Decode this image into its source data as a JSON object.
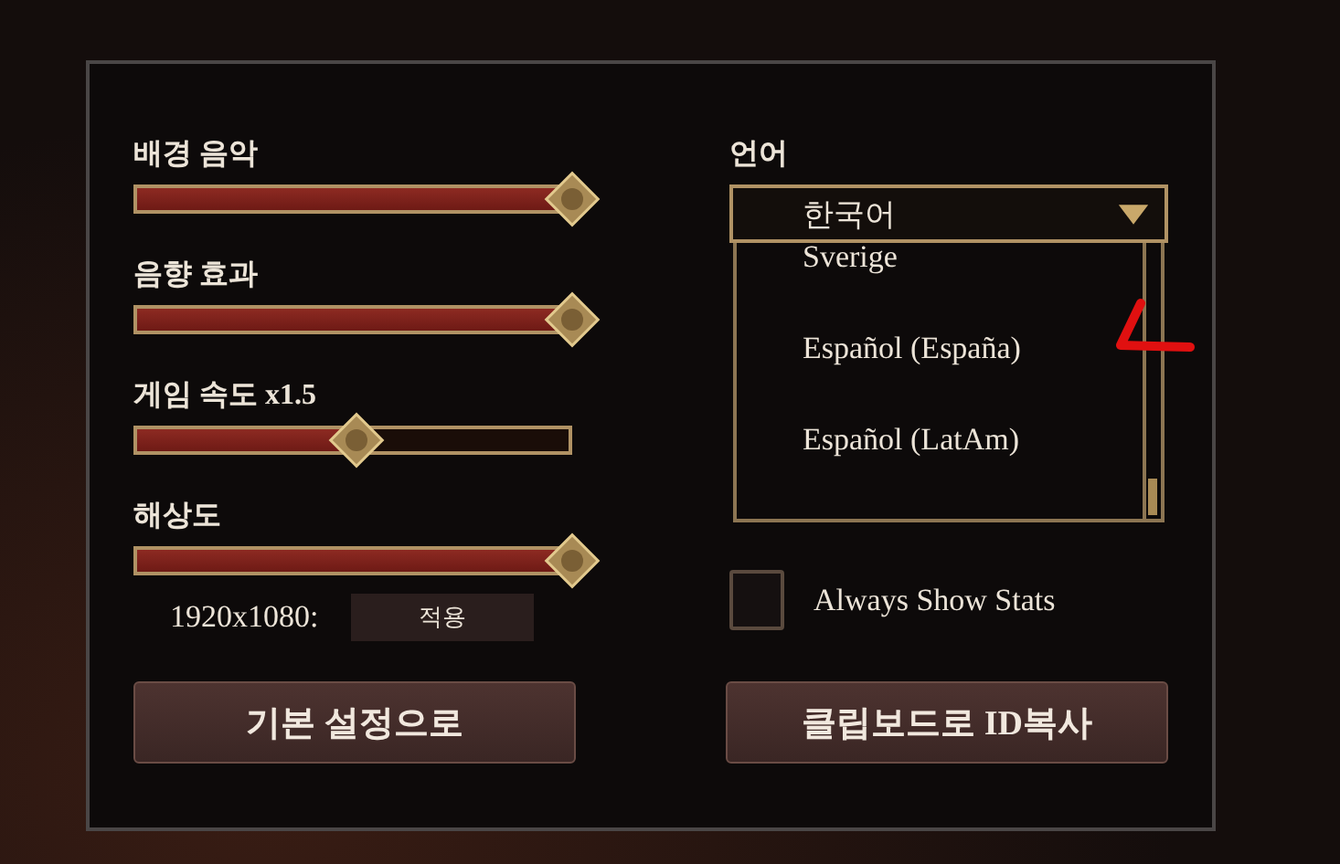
{
  "sliders": [
    {
      "label": "배경 음악",
      "level": 1.0
    },
    {
      "label": "음향 효과",
      "level": 1.0
    },
    {
      "label": "게임 속도 x1.5",
      "level": 0.51
    },
    {
      "label": "해상도",
      "level": 1.0
    }
  ],
  "resolution": {
    "value": "1920x1080:",
    "apply_button": "적용"
  },
  "language": {
    "label": "언어",
    "value": "한국어",
    "expanded": true,
    "options": [
      {
        "label": "Sverige"
      },
      {
        "label": "Español (España)"
      },
      {
        "label": "Español (LatAm)"
      }
    ]
  },
  "always_show_stats": {
    "label": "Always Show Stats",
    "checked": false
  },
  "buttons": [
    "기본 설정으로",
    "클립보드로 ID복사"
  ]
}
